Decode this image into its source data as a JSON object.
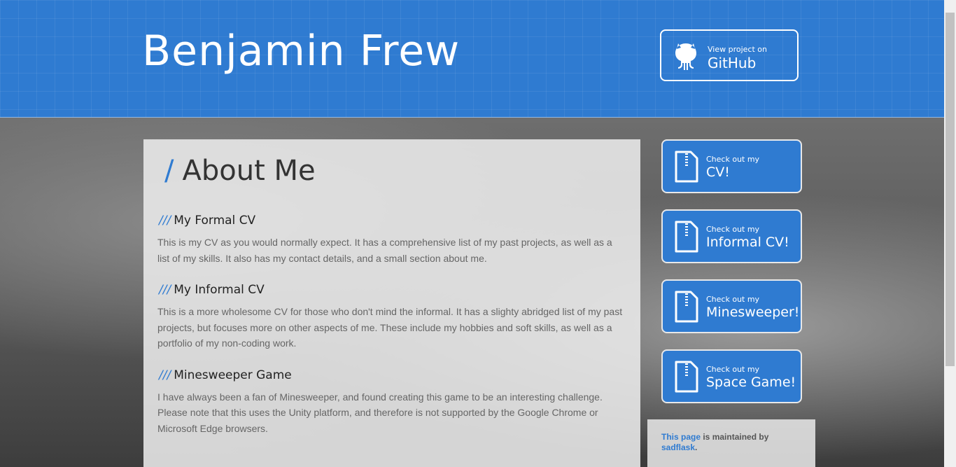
{
  "header": {
    "title": "Benjamin Frew",
    "github_small": "View project on",
    "github_big": "GitHub"
  },
  "main": {
    "title_slash": "/",
    "title": "About Me",
    "sections": [
      {
        "slashes": "///",
        "heading": "My Formal CV",
        "text": "This is my CV as you would normally expect. It has a comprehensive list of my past projects, as well as a list of my skills. It also has my contact details, and a small section about me."
      },
      {
        "slashes": "///",
        "heading": "My Informal CV",
        "text": "This is a more wholesome CV for those who don't mind the informal. It has a slighty abridged list of my past projects, but focuses more on other aspects of me. These include my hobbies and soft skills, as well as a portfolio of my non-coding work."
      },
      {
        "slashes": "///",
        "heading": "Minesweeper Game",
        "text": "I have always been a fan of Minesweeper, and found creating this game to be an interesting challenge. Please note that this uses the Unity platform, and therefore is not supported by the Google Chrome or Microsoft Edge browsers."
      }
    ]
  },
  "sidebar": {
    "buttons": [
      {
        "small": "Check out my",
        "big": "CV!"
      },
      {
        "small": "Check out my",
        "big": "Informal CV!"
      },
      {
        "small": "Check out my",
        "big": "Minesweeper!"
      },
      {
        "small": "Check out my",
        "big": "Space Game!"
      }
    ],
    "maintained": {
      "link1": "This page",
      "middle": " is maintained by ",
      "link2": "sadflask",
      "end": "."
    }
  },
  "colors": {
    "accent": "#2f7bd1"
  }
}
